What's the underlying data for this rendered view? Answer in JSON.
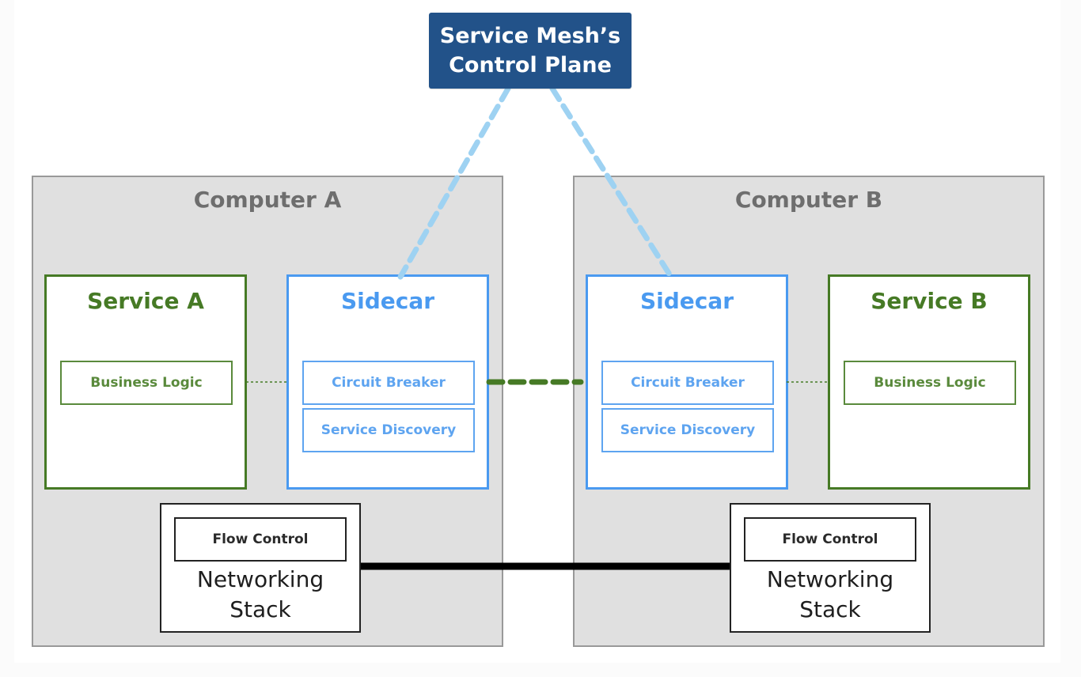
{
  "diagram": {
    "control_plane": {
      "line1": "Service Mesh’s",
      "line2": "Control Plane"
    },
    "computers": [
      {
        "title": "Computer A",
        "service": {
          "title": "Service A",
          "component": "Business Logic"
        },
        "sidecar": {
          "title": "Sidecar",
          "components": [
            "Circuit Breaker",
            "Service Discovery"
          ]
        },
        "networking": {
          "component": "Flow Control",
          "line1": "Networking",
          "line2": "Stack"
        }
      },
      {
        "title": "Computer B",
        "service": {
          "title": "Service B",
          "component": "Business Logic"
        },
        "sidecar": {
          "title": "Sidecar",
          "components": [
            "Circuit Breaker",
            "Service Discovery"
          ]
        },
        "networking": {
          "component": "Flow Control",
          "line1": "Networking",
          "line2": "Stack"
        }
      }
    ],
    "connections": [
      {
        "from": "Service Mesh’s Control Plane",
        "to": "Sidecar (Computer A)",
        "style": "dashed",
        "color": "#9ed2f2"
      },
      {
        "from": "Service Mesh’s Control Plane",
        "to": "Sidecar (Computer B)",
        "style": "dashed",
        "color": "#9ed2f2"
      },
      {
        "from": "Circuit Breaker (A)",
        "to": "Circuit Breaker (B)",
        "style": "dashed",
        "color": "#467a25"
      },
      {
        "from": "Business Logic (A)",
        "to": "Sidecar (A)",
        "style": "dotted",
        "color": "#467a25"
      },
      {
        "from": "Sidecar (B)",
        "to": "Business Logic (B)",
        "style": "dotted",
        "color": "#467a25"
      },
      {
        "from": "Networking Stack (A)",
        "to": "Networking Stack (B)",
        "style": "solid",
        "color": "#000000"
      }
    ],
    "colors": {
      "control_plane": "#225289",
      "computer_bg": "#e0e0e0",
      "service": "#467a25",
      "sidecar": "#4a9af0",
      "networking": "#222222"
    }
  }
}
